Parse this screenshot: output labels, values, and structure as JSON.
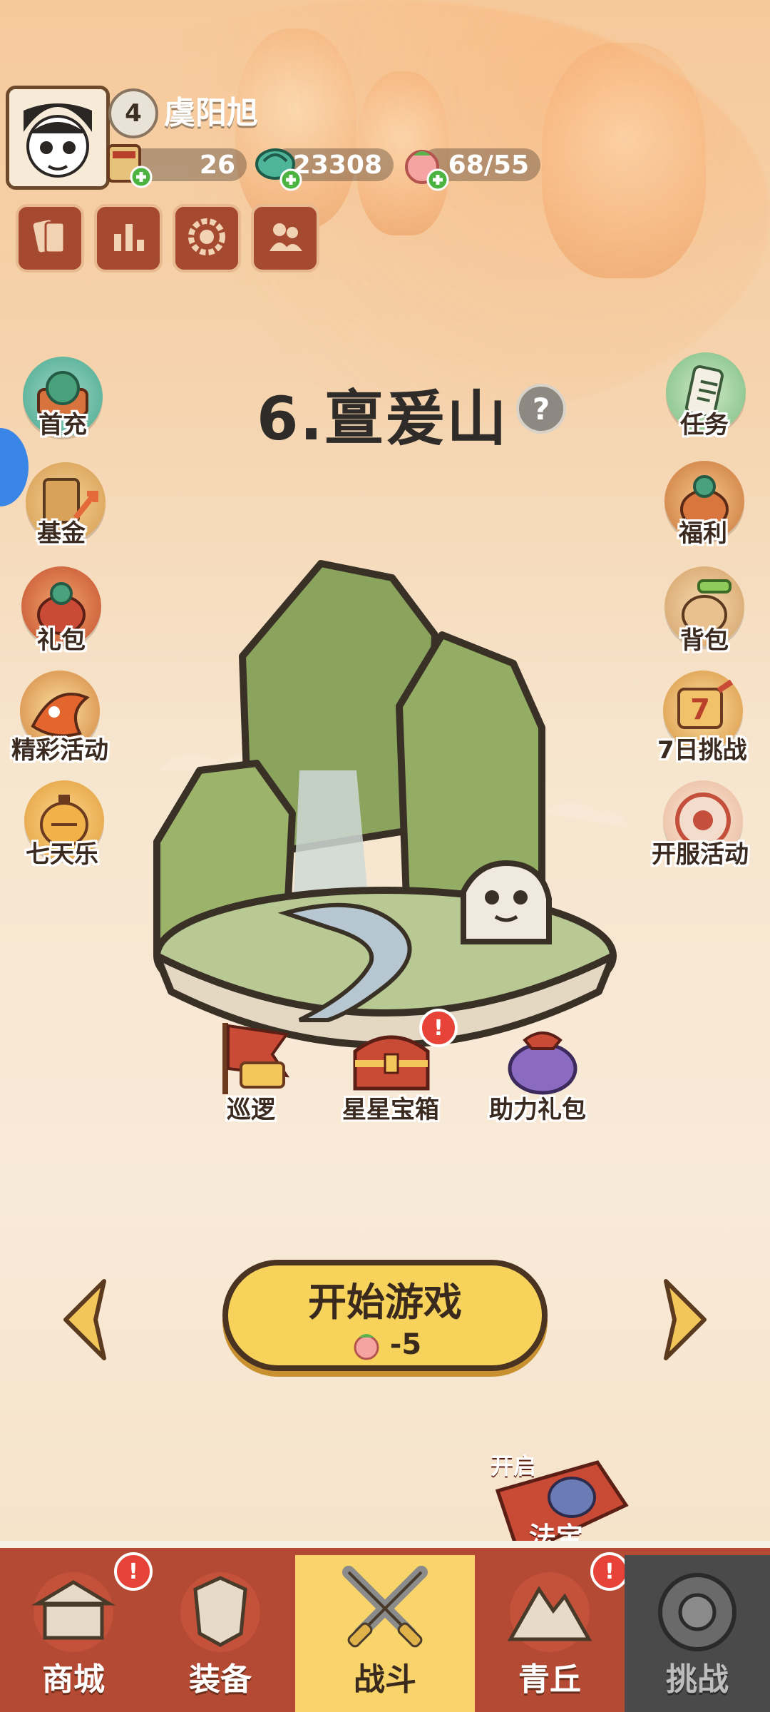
{
  "player": {
    "level": "4",
    "name": "虞阳旭"
  },
  "resources": [
    {
      "icon": "ticket-icon",
      "value": "26"
    },
    {
      "icon": "jade-coin-icon",
      "value": "23308"
    },
    {
      "icon": "peach-icon",
      "value": "68/55"
    }
  ],
  "top_buttons": [
    {
      "icon": "cards-icon"
    },
    {
      "icon": "rank-icon"
    },
    {
      "icon": "settings-icon"
    },
    {
      "icon": "friends-icon"
    }
  ],
  "stage": {
    "title": "6.亶爰山",
    "help": "?"
  },
  "left_menu": [
    {
      "label": "首充",
      "icon": "first-charge-icon"
    },
    {
      "label": "基金",
      "icon": "fund-icon"
    },
    {
      "label": "礼包",
      "icon": "gift-pack-icon"
    },
    {
      "label": "精彩活动",
      "icon": "events-icon"
    },
    {
      "label": "七天乐",
      "icon": "seven-day-icon"
    }
  ],
  "right_menu": [
    {
      "label": "任务",
      "icon": "task-scroll-icon"
    },
    {
      "label": "福利",
      "icon": "welfare-bag-icon"
    },
    {
      "label": "背包",
      "icon": "backpack-icon"
    },
    {
      "label": "7日挑战",
      "icon": "seven-day-challenge-icon"
    },
    {
      "label": "开服活动",
      "icon": "server-open-event-icon"
    }
  ],
  "stage_actions": [
    {
      "label": "巡逻",
      "icon": "patrol-flag-icon"
    },
    {
      "label": "星星宝箱",
      "icon": "star-chest-icon",
      "badge": "!"
    },
    {
      "label": "助力礼包",
      "icon": "assist-bag-icon"
    }
  ],
  "start": {
    "label": "开始游戏",
    "cost": "-5"
  },
  "unlock": {
    "tag": "开启",
    "label": "法宝"
  },
  "nav": [
    {
      "label": "商城",
      "icon": "shop-icon",
      "badge": "!"
    },
    {
      "label": "装备",
      "icon": "armor-icon"
    },
    {
      "label": "战斗",
      "icon": "crossed-swords-icon"
    },
    {
      "label": "青丘",
      "icon": "mountain-icon",
      "badge": "!"
    },
    {
      "label": "挑战",
      "icon": "challenge-icon"
    }
  ],
  "colors": {
    "accent_yellow": "#f7d35b",
    "nav_red": "#b44a34",
    "nav_active": "#f8d46a",
    "nav_locked": "#4a4a4a"
  }
}
